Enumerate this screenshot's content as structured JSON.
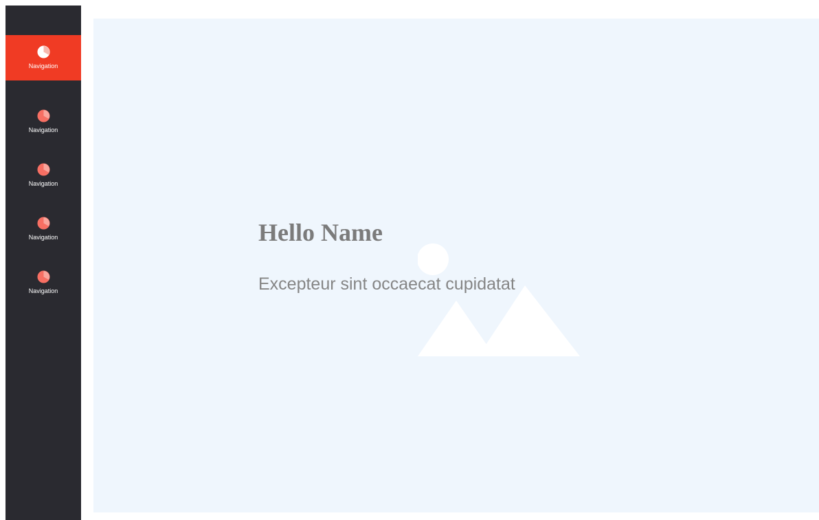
{
  "sidebar": {
    "items": [
      {
        "label": "Navigation",
        "icon": "pie-chart-icon",
        "active": true
      },
      {
        "label": "Navigation",
        "icon": "pie-chart-icon",
        "active": false
      },
      {
        "label": "Navigation",
        "icon": "pie-chart-icon",
        "active": false
      },
      {
        "label": "Navigation",
        "icon": "pie-chart-icon",
        "active": false
      },
      {
        "label": "Navigation",
        "icon": "pie-chart-icon",
        "active": false
      }
    ]
  },
  "main": {
    "title": "Hello Name",
    "subtitle": "Excepteur sint occaecat cupidatat",
    "background_icon": "image-placeholder-icon"
  },
  "colors": {
    "sidebar_bg": "#2a2a30",
    "accent": "#f03b24",
    "icon_pink": "#f76f63",
    "main_bg": "#eff6fd",
    "title_text": "#7b7b7b"
  }
}
